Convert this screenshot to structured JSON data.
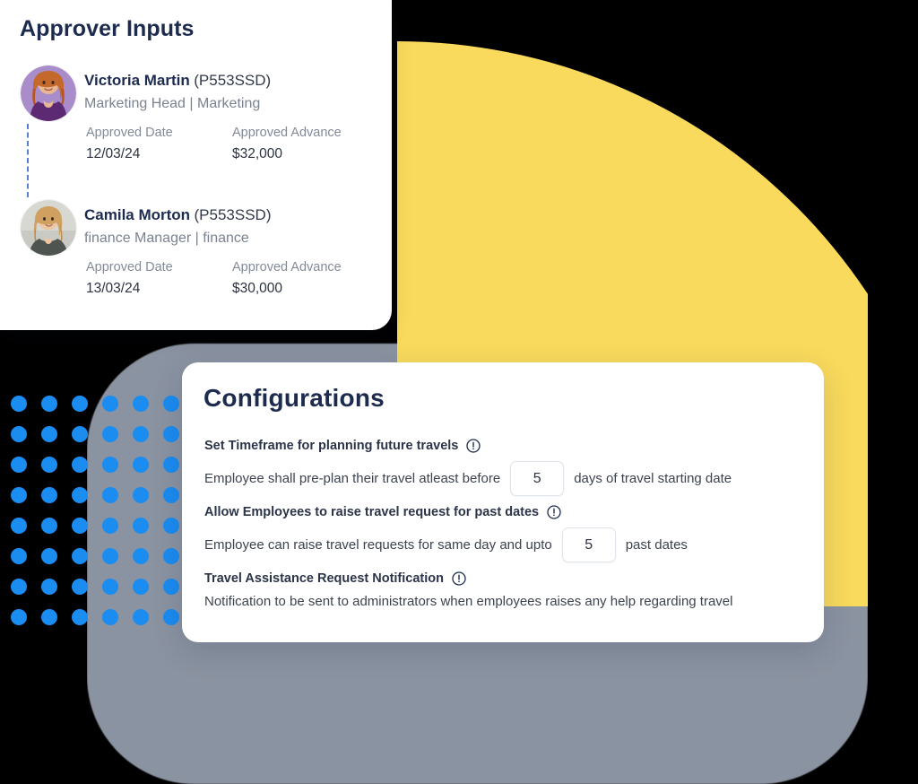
{
  "theme": {
    "yellow": "#f9da5c",
    "grey": "#8a93a1",
    "blue_dot": "#1b8cf0",
    "navy_text": "#1d2b4f",
    "background": "#000000"
  },
  "approver_card": {
    "title": "Approver Inputs",
    "people": [
      {
        "name": "Victoria Martin",
        "employee_id": "(P553SSD)",
        "role": "Marketing Head | Marketing",
        "fields": [
          {
            "label": "Approved Date",
            "value": "12/03/24"
          },
          {
            "label": "Approved Advance",
            "value": "$32,000"
          }
        ],
        "avatar": "avatar-victoria-martin"
      },
      {
        "name": "Camila Morton",
        "employee_id": "(P553SSD)",
        "role": "finance Manager | finance",
        "fields": [
          {
            "label": "Approved Date",
            "value": "13/03/24"
          },
          {
            "label": "Approved Advance",
            "value": "$30,000"
          }
        ],
        "avatar": "avatar-camila-morton"
      }
    ]
  },
  "config_card": {
    "title": "Configurations",
    "rows": [
      {
        "heading": "Set Timeframe for planning future travels",
        "info_icon": "info-circle-icon",
        "text_before": "Employee shall pre-plan their travel atleast before",
        "value": "5",
        "text_after": "days of travel starting date"
      },
      {
        "heading": "Allow Employees to raise travel request for past dates",
        "info_icon": "info-circle-icon",
        "text_before": "Employee can raise travel requests for same day and upto",
        "value": "5",
        "text_after": "past dates"
      },
      {
        "heading": "Travel Assistance Request Notification",
        "info_icon": "info-circle-icon",
        "text_before": "Notification to be sent to administrators when employees raises any help regarding travel",
        "value": null,
        "text_after": ""
      }
    ]
  },
  "decor": {
    "dot_grid": {
      "columns": 6,
      "rows": 8,
      "dot_color": "#1b8cf0"
    },
    "yellow_shape": "quarter-circle",
    "grey_shape": "rounded-rectangle"
  }
}
